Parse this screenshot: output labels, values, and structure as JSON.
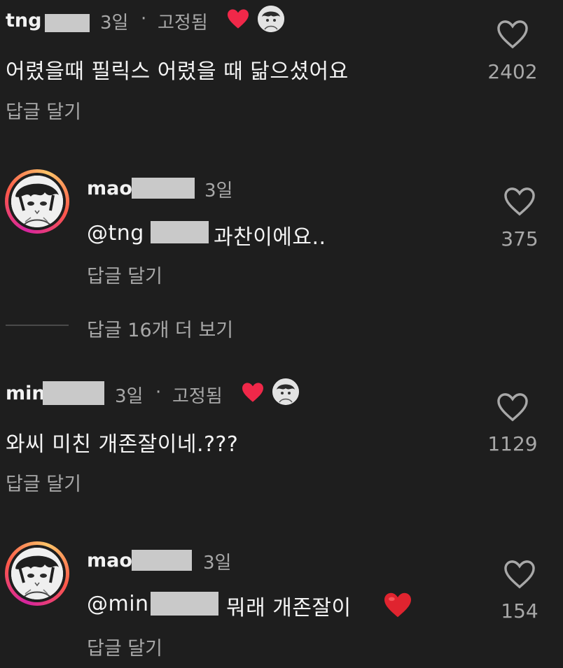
{
  "colors": {
    "background": "#1e1e1e",
    "text": "#f2f2f2",
    "muted": "#a8a8a8",
    "heart_red": "#f02849",
    "avatar_ring": "#d6249f"
  },
  "comments": [
    {
      "username": "tng",
      "time": "3일",
      "separator": "·",
      "pinned_label": "고정됨",
      "text": "어렸을때 필릭스 어렸을 때 닮으셨어요",
      "reply_label": "답글 달기",
      "like_count": "2402",
      "liked_by_creator_icon": "red-heart-icon"
    },
    {
      "username": "mao",
      "time": "3일",
      "mention": "@tng",
      "text": "과찬이에요..",
      "reply_label": "답글 달기",
      "like_count": "375"
    },
    {
      "username": "min",
      "time": "3일",
      "separator": "·",
      "pinned_label": "고정됨",
      "text": "와씨 미친 개존잘이네.???",
      "reply_label": "답글 달기",
      "like_count": "1129",
      "liked_by_creator_icon": "red-heart-icon"
    },
    {
      "username": "mao",
      "time": "3일",
      "mention": "@min",
      "text": "뭐래 개존잘이",
      "text_emoji_icon": "red-heart-emoji",
      "reply_label": "답글 달기",
      "like_count": "154"
    }
  ],
  "view_replies_label": "답글 16개 더 보기"
}
